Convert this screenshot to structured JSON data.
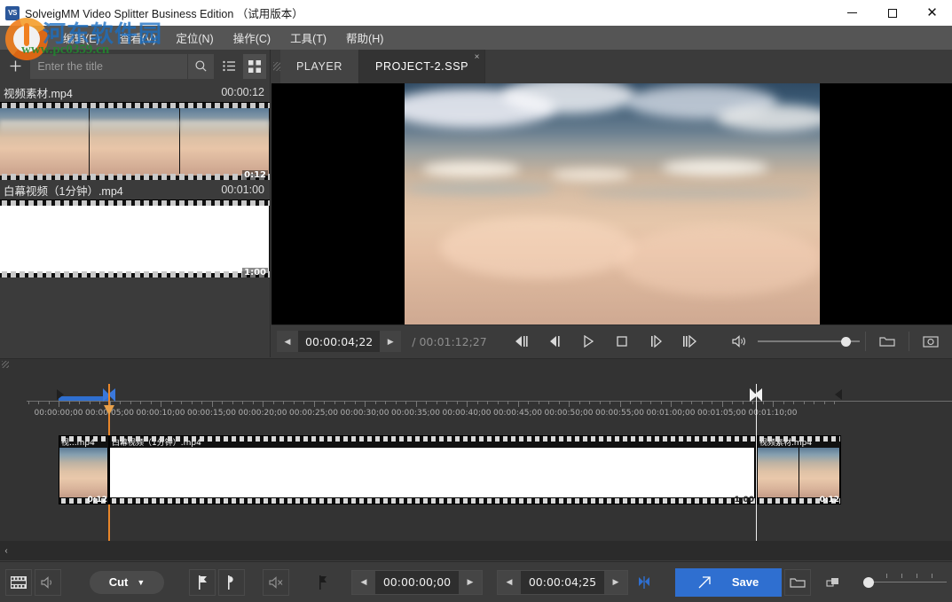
{
  "window": {
    "app_icon_label": "VS",
    "title": "SolveigMM Video Splitter Business Edition （试用版本）",
    "minimize_label": "Minimize",
    "maximize_label": "Maximize",
    "close_label": "Close"
  },
  "watermark": {
    "site_cn": "河东软件园",
    "site_url": "www.pc0359.cn"
  },
  "menu": {
    "items": [
      {
        "label": "编辑(E)"
      },
      {
        "label": "查看(V)"
      },
      {
        "label": "定位(N)"
      },
      {
        "label": "操作(C)"
      },
      {
        "label": "工具(T)"
      },
      {
        "label": "帮助(H)"
      }
    ]
  },
  "media_panel": {
    "add_label": "+",
    "search": {
      "value": "",
      "placeholder": "Enter the title"
    },
    "search_icon": "search-icon",
    "list_view_icon": "list-view-icon",
    "grid_view_icon": "grid-view-icon",
    "items": [
      {
        "name": "视频素材.mp4",
        "duration": "00:00:12",
        "strip_time": "0:12",
        "kind": "photo"
      },
      {
        "name": "白幕视频（1分钟）.mp4",
        "duration": "00:01:00",
        "strip_time": "1:00",
        "kind": "white"
      }
    ]
  },
  "player": {
    "tabs": [
      {
        "label": "PLAYER",
        "active": false,
        "closable": false
      },
      {
        "label": "PROJECT-2.SSP",
        "active": true,
        "closable": true,
        "close_label": "×"
      }
    ],
    "transport": {
      "current_time": "00:00:04;22",
      "total_time": "/ 00:01:12;27",
      "prev_step_label": "◀",
      "next_step_label": "▶",
      "buttons": [
        {
          "name": "prev-frame-button",
          "icon": "prev-frame-icon"
        },
        {
          "name": "step-back-button",
          "icon": "step-back-icon"
        },
        {
          "name": "play-button",
          "icon": "play-icon"
        },
        {
          "name": "stop-button",
          "icon": "stop-icon"
        },
        {
          "name": "step-forward-button",
          "icon": "step-forward-icon"
        },
        {
          "name": "next-frame-button",
          "icon": "next-frame-icon"
        }
      ],
      "volume_icon": "volume-icon",
      "volume_percent": 82,
      "open-folder-icon": "folder-icon",
      "snapshot_icon": "snapshot-icon"
    }
  },
  "timeline": {
    "tick_labels": [
      "00:00:00;00",
      "00:00:05;00",
      "00:00:10;00",
      "00:00:15;00",
      "00:00:20;00",
      "00:00:25;00",
      "00:00:30;00",
      "00:00:35;00",
      "00:00:40;00",
      "00:00:45;00",
      "00:00:50;00",
      "00:00:55;00",
      "00:01:00;00",
      "00:01:05;00",
      "00:01:10;00"
    ],
    "clips": [
      {
        "title": "视...mp4",
        "time_label": "0:12",
        "kind": "photo"
      },
      {
        "title": "白幕视频（1分钟）.mp4",
        "time_label": "1:00",
        "kind": "white"
      },
      {
        "title": "视频素材.mp4",
        "time_label": "0:12",
        "kind": "photo"
      }
    ],
    "scroll_left_label": "‹"
  },
  "bottombar": {
    "video_track_icon": "film-strip-icon",
    "audio_track_icon": "speaker-icon",
    "mode": {
      "label": "Cut",
      "caret": "▼"
    },
    "marker_in_icon": "marker-in-icon",
    "marker_out_icon": "marker-out-icon",
    "mute_icon": "mute-icon",
    "prev_marker_icon": "prev-marker-icon",
    "start_field": {
      "value": "00:00:00;00",
      "dec": "◀",
      "inc": "▶"
    },
    "end_field": {
      "value": "00:00:04;25",
      "dec": "◀",
      "inc": "▶"
    },
    "split_icon": "split-marker-icon",
    "save_button": {
      "label": "Save",
      "icon": "save-arrow-icon",
      "color": "#2f6fd0"
    },
    "output_folder_icon": "folder-icon",
    "zoom_icon": "zoom-scale-icon",
    "zoom_value": 0
  }
}
